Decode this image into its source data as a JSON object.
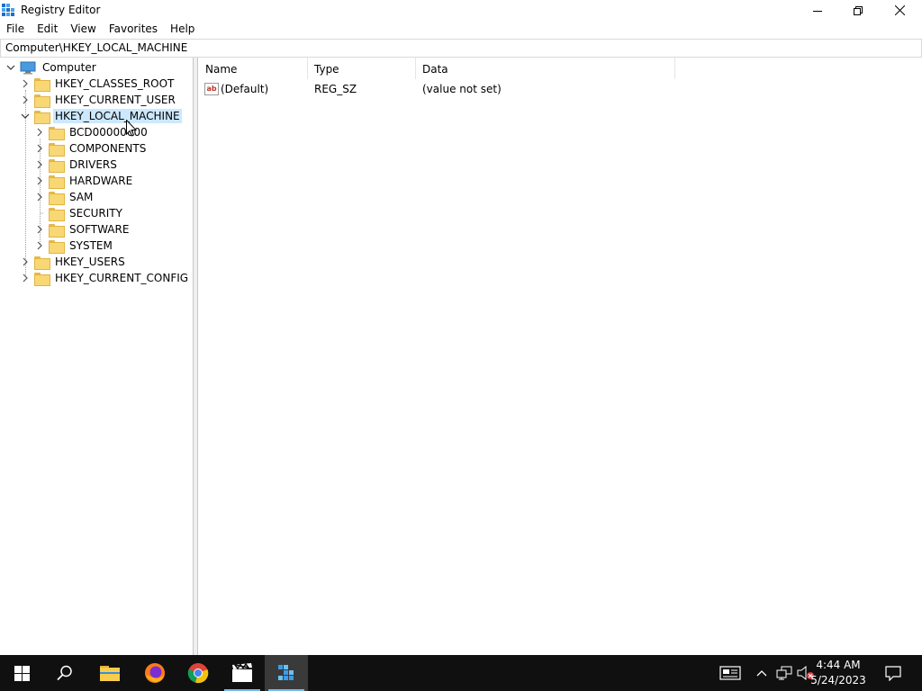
{
  "window": {
    "title": "Registry Editor",
    "icons": {
      "app": "registry-editor-icon",
      "minimize": "minimize-icon",
      "maximize": "restore-icon",
      "close": "close-icon"
    }
  },
  "menu": [
    "File",
    "Edit",
    "View",
    "Favorites",
    "Help"
  ],
  "address": "Computer\\HKEY_LOCAL_MACHINE",
  "tree": {
    "root": "Computer",
    "hives": [
      {
        "label": "HKEY_CLASSES_ROOT",
        "expanded": false
      },
      {
        "label": "HKEY_CURRENT_USER",
        "expanded": false
      },
      {
        "label": "HKEY_LOCAL_MACHINE",
        "expanded": true,
        "selected": true,
        "children": [
          "BCD00000000",
          "COMPONENTS",
          "DRIVERS",
          "HARDWARE",
          "SAM",
          "SECURITY",
          "SOFTWARE",
          "SYSTEM"
        ]
      },
      {
        "label": "HKEY_USERS",
        "expanded": false
      },
      {
        "label": "HKEY_CURRENT_CONFIG",
        "expanded": false
      }
    ]
  },
  "list": {
    "columns": [
      "Name",
      "Type",
      "Data"
    ],
    "rows": [
      {
        "name": "(Default)",
        "type": "REG_SZ",
        "data": "(value not set)",
        "icon": "string-value-icon"
      }
    ]
  },
  "taskbar": {
    "apps": [
      "windows-start-icon",
      "search-icon",
      "file-explorer-icon",
      "firefox-icon",
      "chrome-icon",
      "video-editor-icon",
      "registry-editor-icon"
    ],
    "active": "registry-editor-icon",
    "clock": {
      "time": "4:44 AM",
      "date": "5/24/2023"
    },
    "accent": "#76b9ed"
  },
  "colors": {
    "selection": "#cce8ff",
    "folder": "#f8d775",
    "taskbar": "#101010"
  }
}
